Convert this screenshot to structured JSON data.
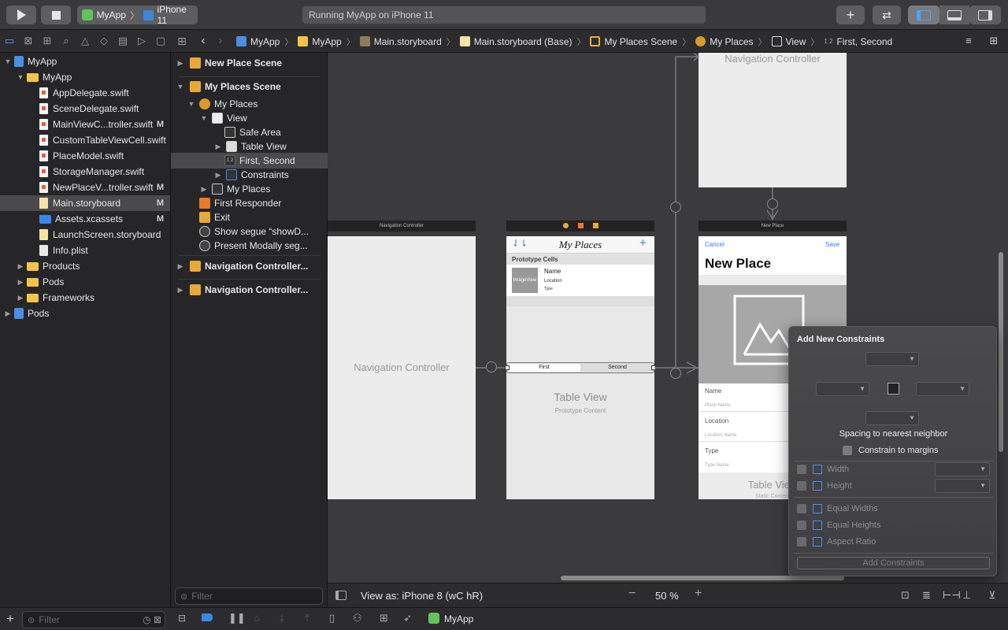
{
  "toolbar": {
    "scheme_app": "MyApp",
    "scheme_device": "iPhone 11",
    "status": "Running MyApp on iPhone 11"
  },
  "breadcrumb": [
    "MyApp",
    "MyApp",
    "Main.storyboard",
    "Main.storyboard (Base)",
    "My Places Scene",
    "My Places",
    "View",
    "First, Second"
  ],
  "navigator": {
    "items": [
      {
        "label": "MyApp",
        "icon": "project-icon",
        "level": 0,
        "badge": ""
      },
      {
        "label": "MyApp",
        "icon": "folder-icon",
        "level": 1,
        "badge": ""
      },
      {
        "label": "AppDelegate.swift",
        "icon": "swift-file-icon",
        "level": 2,
        "badge": ""
      },
      {
        "label": "SceneDelegate.swift",
        "icon": "swift-file-icon",
        "level": 2,
        "badge": ""
      },
      {
        "label": "MainViewC...troller.swift",
        "icon": "swift-file-icon",
        "level": 2,
        "badge": "M"
      },
      {
        "label": "CustomTableViewCell.swift",
        "icon": "swift-file-icon",
        "level": 2,
        "badge": ""
      },
      {
        "label": "PlaceModel.swift",
        "icon": "swift-file-icon",
        "level": 2,
        "badge": ""
      },
      {
        "label": "StorageManager.swift",
        "icon": "swift-file-icon",
        "level": 2,
        "badge": ""
      },
      {
        "label": "NewPlaceV...troller.swift",
        "icon": "swift-file-icon",
        "level": 2,
        "badge": "M"
      },
      {
        "label": "Main.storyboard",
        "icon": "storyboard-icon",
        "level": 2,
        "badge": "M"
      },
      {
        "label": "Assets.xcassets",
        "icon": "assets-icon",
        "level": 2,
        "badge": "M"
      },
      {
        "label": "LaunchScreen.storyboard",
        "icon": "storyboard-icon",
        "level": 2,
        "badge": ""
      },
      {
        "label": "Info.plist",
        "icon": "plist-icon",
        "level": 2,
        "badge": ""
      },
      {
        "label": "Products",
        "icon": "folder-icon",
        "level": 1,
        "badge": ""
      },
      {
        "label": "Pods",
        "icon": "folder-icon",
        "level": 1,
        "badge": ""
      },
      {
        "label": "Frameworks",
        "icon": "folder-icon",
        "level": 1,
        "badge": ""
      },
      {
        "label": "Pods",
        "icon": "project-icon",
        "level": 0,
        "badge": ""
      }
    ],
    "filter_placeholder": "Filter"
  },
  "outline": {
    "items": [
      "New Place Scene",
      "My Places Scene",
      "My Places",
      "View",
      "Safe Area",
      "Table View",
      "First, Second",
      "Constraints",
      "My Places",
      "First Responder",
      "Exit",
      "Show segue “showD...",
      "Present Modally seg...",
      "Navigation Controller...",
      "Navigation Controller..."
    ],
    "filter_placeholder": "Filter"
  },
  "canvas": {
    "nav_controller_title": "Navigation Controller",
    "nav_controller_body": "Navigation Controller",
    "top_nav_controller": "Navigation Controller",
    "my_places_title": "My Places",
    "prototype_cells": "Prototype Cells",
    "cell_image": "ImageView",
    "cell_name": "Name",
    "cell_location": "Location",
    "cell_type": "Type",
    "seg_first": "First",
    "seg_second": "Second",
    "table_view": "Table View",
    "prototype_content": "Prototype Content",
    "new_place_header": "New Place",
    "cancel": "Cancel",
    "save": "Save",
    "new_place_title": "New Place",
    "name_label": "Name",
    "name_placeholder": "Place Name",
    "location_label": "Location",
    "location_placeholder": "Location Name",
    "type_label": "Type",
    "type_placeholder": "Type Name",
    "table_view_2": "Table View",
    "static_content": "Static Content"
  },
  "bottombar": {
    "view_as": "View as: iPhone 8 (wC hR)",
    "zoom": "50 %"
  },
  "popover": {
    "title": "Add New Constraints",
    "spacing_label": "Spacing to nearest neighbor",
    "constrain_margins": "Constrain to margins",
    "width": "Width",
    "height": "Height",
    "equal_widths": "Equal Widths",
    "equal_heights": "Equal Heights",
    "aspect_ratio": "Aspect Ratio",
    "add_button": "Add Constraints"
  },
  "statusbar": {
    "filter_placeholder": "Filter",
    "scheme": "MyApp"
  }
}
